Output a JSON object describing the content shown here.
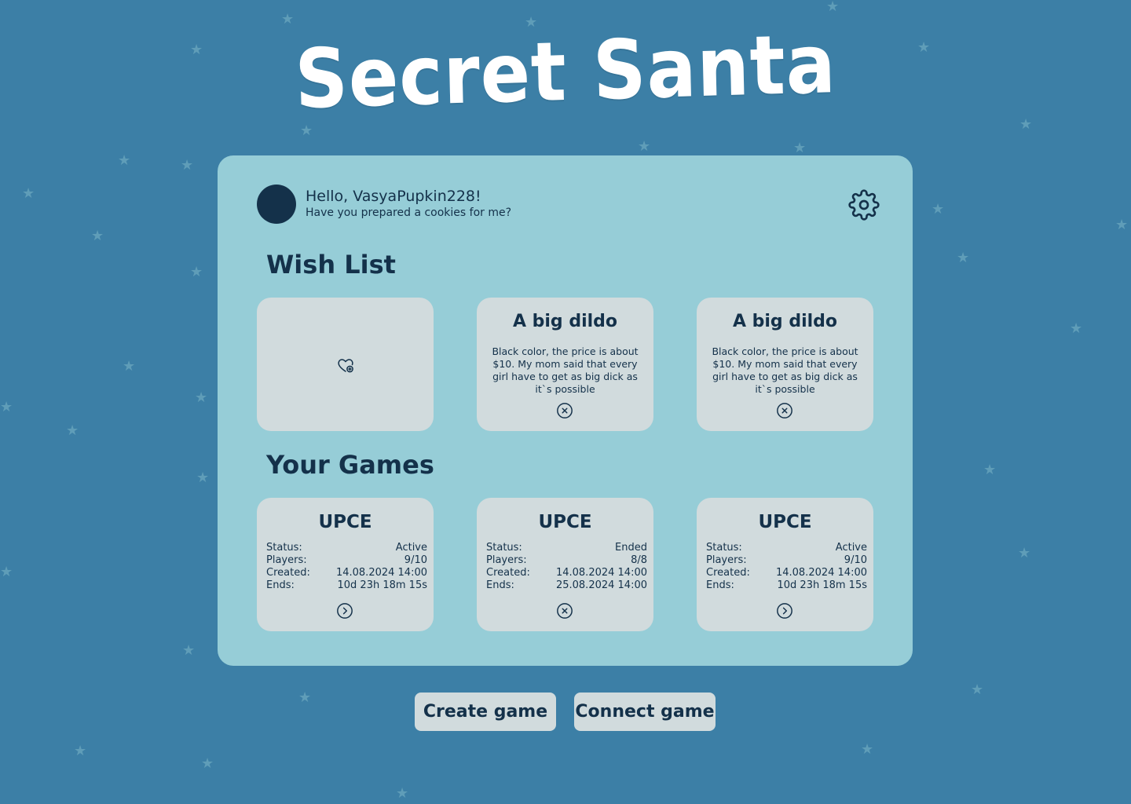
{
  "app": {
    "title": "Secret Santa"
  },
  "user": {
    "greeting": "Hello, VasyaPupkin228!",
    "subtitle": "Have you prepared a cookies for me?"
  },
  "wishlist": {
    "title": "Wish List",
    "items": [
      {
        "name": "A big dildo",
        "description": "Black color, the price is about $10. My mom said that every girl have to get as big dick as it`s possible"
      },
      {
        "name": "A big dildo",
        "description": "Black color, the price is about $10. My mom said that every girl have to get as big dick as it`s possible"
      }
    ]
  },
  "games": {
    "title": "Your Games",
    "labels": {
      "status": "Status:",
      "players": "Players:",
      "created": "Created:",
      "ends": "Ends:"
    },
    "items": [
      {
        "name": "UPCE",
        "status": "Active",
        "players": "9/10",
        "created": "14.08.2024 14:00",
        "ends": "10d 23h 18m 15s",
        "action_icon": "chevron-right-circle-icon"
      },
      {
        "name": "UPCE",
        "status": "Ended",
        "players": "8/8",
        "created": "14.08.2024 14:00",
        "ends": "25.08.2024 14:00",
        "action_icon": "close-circle-icon"
      },
      {
        "name": "UPCE",
        "status": "Active",
        "players": "9/10",
        "created": "14.08.2024 14:00",
        "ends": "10d 23h 18m 15s",
        "action_icon": "chevron-right-circle-icon"
      }
    ]
  },
  "buttons": {
    "create": "Create game",
    "connect": "Connect game"
  },
  "colors": {
    "background": "#3c7fa6",
    "panel": "#96cdd7",
    "card": "#d1dbdd",
    "text": "#14314a",
    "star": "#5f9db8"
  }
}
